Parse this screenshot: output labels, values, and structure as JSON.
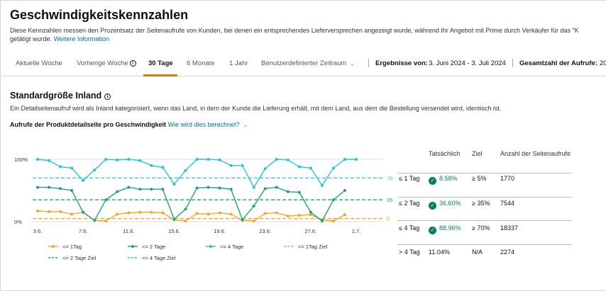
{
  "page": {
    "title": "Geschwindigkeitskennzahlen",
    "desc_line1": "Diese Kennzahlen messen den Prozentsatz der Seitenaufrufe von Kunden, bei denen ein entsprechendes Lieferversprechen angezeigt wurde, während Ihr Angebot mit Prime durch Verkäufer für das \"K",
    "desc_line2": "getätigt wurde.",
    "more_link": "Weitere Information"
  },
  "tabs": [
    {
      "label": "Aktuelle Woche"
    },
    {
      "label": "Vorherige Woche"
    },
    {
      "label": "30 Tage"
    },
    {
      "label": "6 Monate"
    },
    {
      "label": "1 Jahr"
    },
    {
      "label": "Benutzerdefinierter Zeitraum"
    }
  ],
  "meta": {
    "results_label": "Ergebnisse von:",
    "results_value": "3. Juni 2024 - 3. Juli 2024",
    "views_label": "Gesamtzahl der Aufrufe:",
    "views_value": "20"
  },
  "section": {
    "title": "Standardgröße Inland",
    "desc": "Ein Detailseitenaufruf wird als Inland kategorisiert, wenn das Land, in dem der Kunde die Lieferung erhält, mit dem Land, aus dem die Bestellung versendet wird, identisch ist.",
    "sub_title": "Aufrufe der Produktdetailseite pro Geschwindigkeit",
    "how_link": "Wie wird dies berechnet?"
  },
  "table": {
    "headers": [
      "Tatsächlich",
      "Ziel",
      "Anzahl der Seitenaufrufe"
    ],
    "rows": [
      {
        "label": "≤ 1 Tag",
        "actual": "8.58%",
        "target": "≥ 5%",
        "views": "1770",
        "met": true
      },
      {
        "label": "≤ 2 Tag",
        "actual": "36.60%",
        "target": "≥ 35%",
        "views": "7544",
        "met": true
      },
      {
        "label": "≤ 4 Tag",
        "actual": "88.96%",
        "target": "≥ 70%",
        "views": "18337",
        "met": true
      },
      {
        "label": "> 4 Tag",
        "actual": "11.04%",
        "target": "N/A",
        "views": "2274",
        "met": false
      }
    ]
  },
  "colors": {
    "orange": "#f5a623",
    "green": "#1fa37a",
    "cyan": "#25c4db",
    "tab_accent": "#e77600",
    "link": "#007185",
    "check": "#067d62"
  },
  "chart_data": {
    "type": "line",
    "y_tick_labels": [
      "100%",
      "0%"
    ],
    "ylim": [
      0,
      100
    ],
    "x_tick_labels": [
      "3.6.",
      "7.6.",
      "11.6.",
      "15.6.",
      "19.6.",
      "23.6.",
      "27.6.",
      "1.7."
    ],
    "series": [
      {
        "name": "<= 1Tag",
        "color": "#f5a623",
        "values": [
          17,
          16,
          16,
          12,
          15,
          2,
          1,
          12,
          14,
          15,
          15,
          14,
          3,
          1,
          13,
          12,
          14,
          12,
          2,
          1,
          13,
          14,
          9,
          10,
          11,
          3,
          1,
          11
        ]
      },
      {
        "name": "<= 2 Tage",
        "color": "#1fa37a",
        "values": [
          55,
          55,
          53,
          50,
          15,
          2,
          35,
          48,
          55,
          52,
          52,
          52,
          4,
          20,
          54,
          55,
          54,
          52,
          3,
          25,
          53,
          55,
          48,
          47,
          15,
          1,
          35,
          50
        ]
      },
      {
        "name": "<= 4 Tage",
        "color": "#25c4db",
        "values": [
          100,
          98,
          88,
          86,
          66,
          83,
          100,
          99,
          100,
          98,
          90,
          87,
          60,
          82,
          100,
          100,
          99,
          90,
          90,
          55,
          85,
          100,
          99,
          88,
          86,
          58,
          86,
          100,
          100
        ]
      }
    ],
    "targets": [
      {
        "name": "<= 1Tag Ziel",
        "value": 5,
        "label": "5",
        "color": "#f5a623"
      },
      {
        "name": "<= 2 Tage Ziel",
        "value": 35,
        "label": "35",
        "color": "#1fa37a"
      },
      {
        "name": "<= 4 Tage Ziel",
        "value": 70,
        "label": "70",
        "color": "#25c4db"
      }
    ]
  }
}
